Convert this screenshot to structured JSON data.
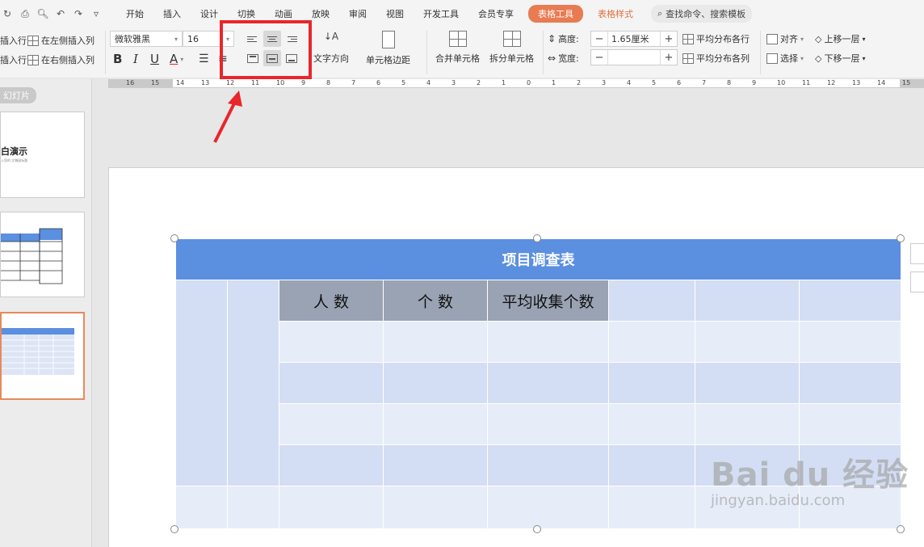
{
  "quick_access": [
    "refresh-icon",
    "print-icon",
    "preview-icon",
    "undo-icon",
    "redo-icon",
    "more-icon"
  ],
  "menu": {
    "tabs": [
      "开始",
      "插入",
      "设计",
      "切换",
      "动画",
      "放映",
      "审阅",
      "视图",
      "开发工具",
      "会员专享"
    ],
    "table_tool": "表格工具",
    "table_style": "表格样式",
    "search": "查找命令、搜索模板"
  },
  "ribbon": {
    "insert_row_above": "插入行",
    "insert_row_below": "插入行",
    "insert_col_left": "在左侧插入列",
    "insert_col_right": "在右侧插入列",
    "font_name": "微软雅黑",
    "font_size": "16",
    "bold": "B",
    "italic": "I",
    "underline": "U",
    "font_color": "A",
    "text_direction": "文字方向",
    "cell_margin": "单元格边距",
    "merge_cells": "合并单元格",
    "split_cells": "拆分单元格",
    "height_label": "高度:",
    "height_value": "1.65厘米",
    "width_label": "宽度:",
    "width_value": "",
    "distribute_rows": "平均分布各行",
    "distribute_cols": "平均分布各列",
    "align": "对齐",
    "select": "选择",
    "bring_forward": "上移一层",
    "send_backward": "下移一层"
  },
  "ruler_ticks": [
    "16",
    "15",
    "14",
    "13",
    "12",
    "11",
    "10",
    "9",
    "8",
    "7",
    "6",
    "5",
    "4",
    "3",
    "2",
    "1",
    "0",
    "1",
    "2",
    "3",
    "4",
    "5",
    "6",
    "7",
    "8",
    "9",
    "10",
    "11",
    "12",
    "13",
    "14",
    "15"
  ],
  "left_panel": {
    "label": "幻灯片",
    "slide1_title": "白演示",
    "slide1_subtitle": "入您的 文稿副标题"
  },
  "table": {
    "title": "项目调查表",
    "headers": [
      "人 数",
      "个 数",
      "平均收集个数"
    ]
  },
  "watermark": {
    "line1": "Bai du 经验",
    "line2": "jingyan.baidu.com"
  },
  "colors": {
    "table_header": "#5b8fe0",
    "highlight": "#e8262c",
    "table_tool_tab": "#e97b52"
  }
}
